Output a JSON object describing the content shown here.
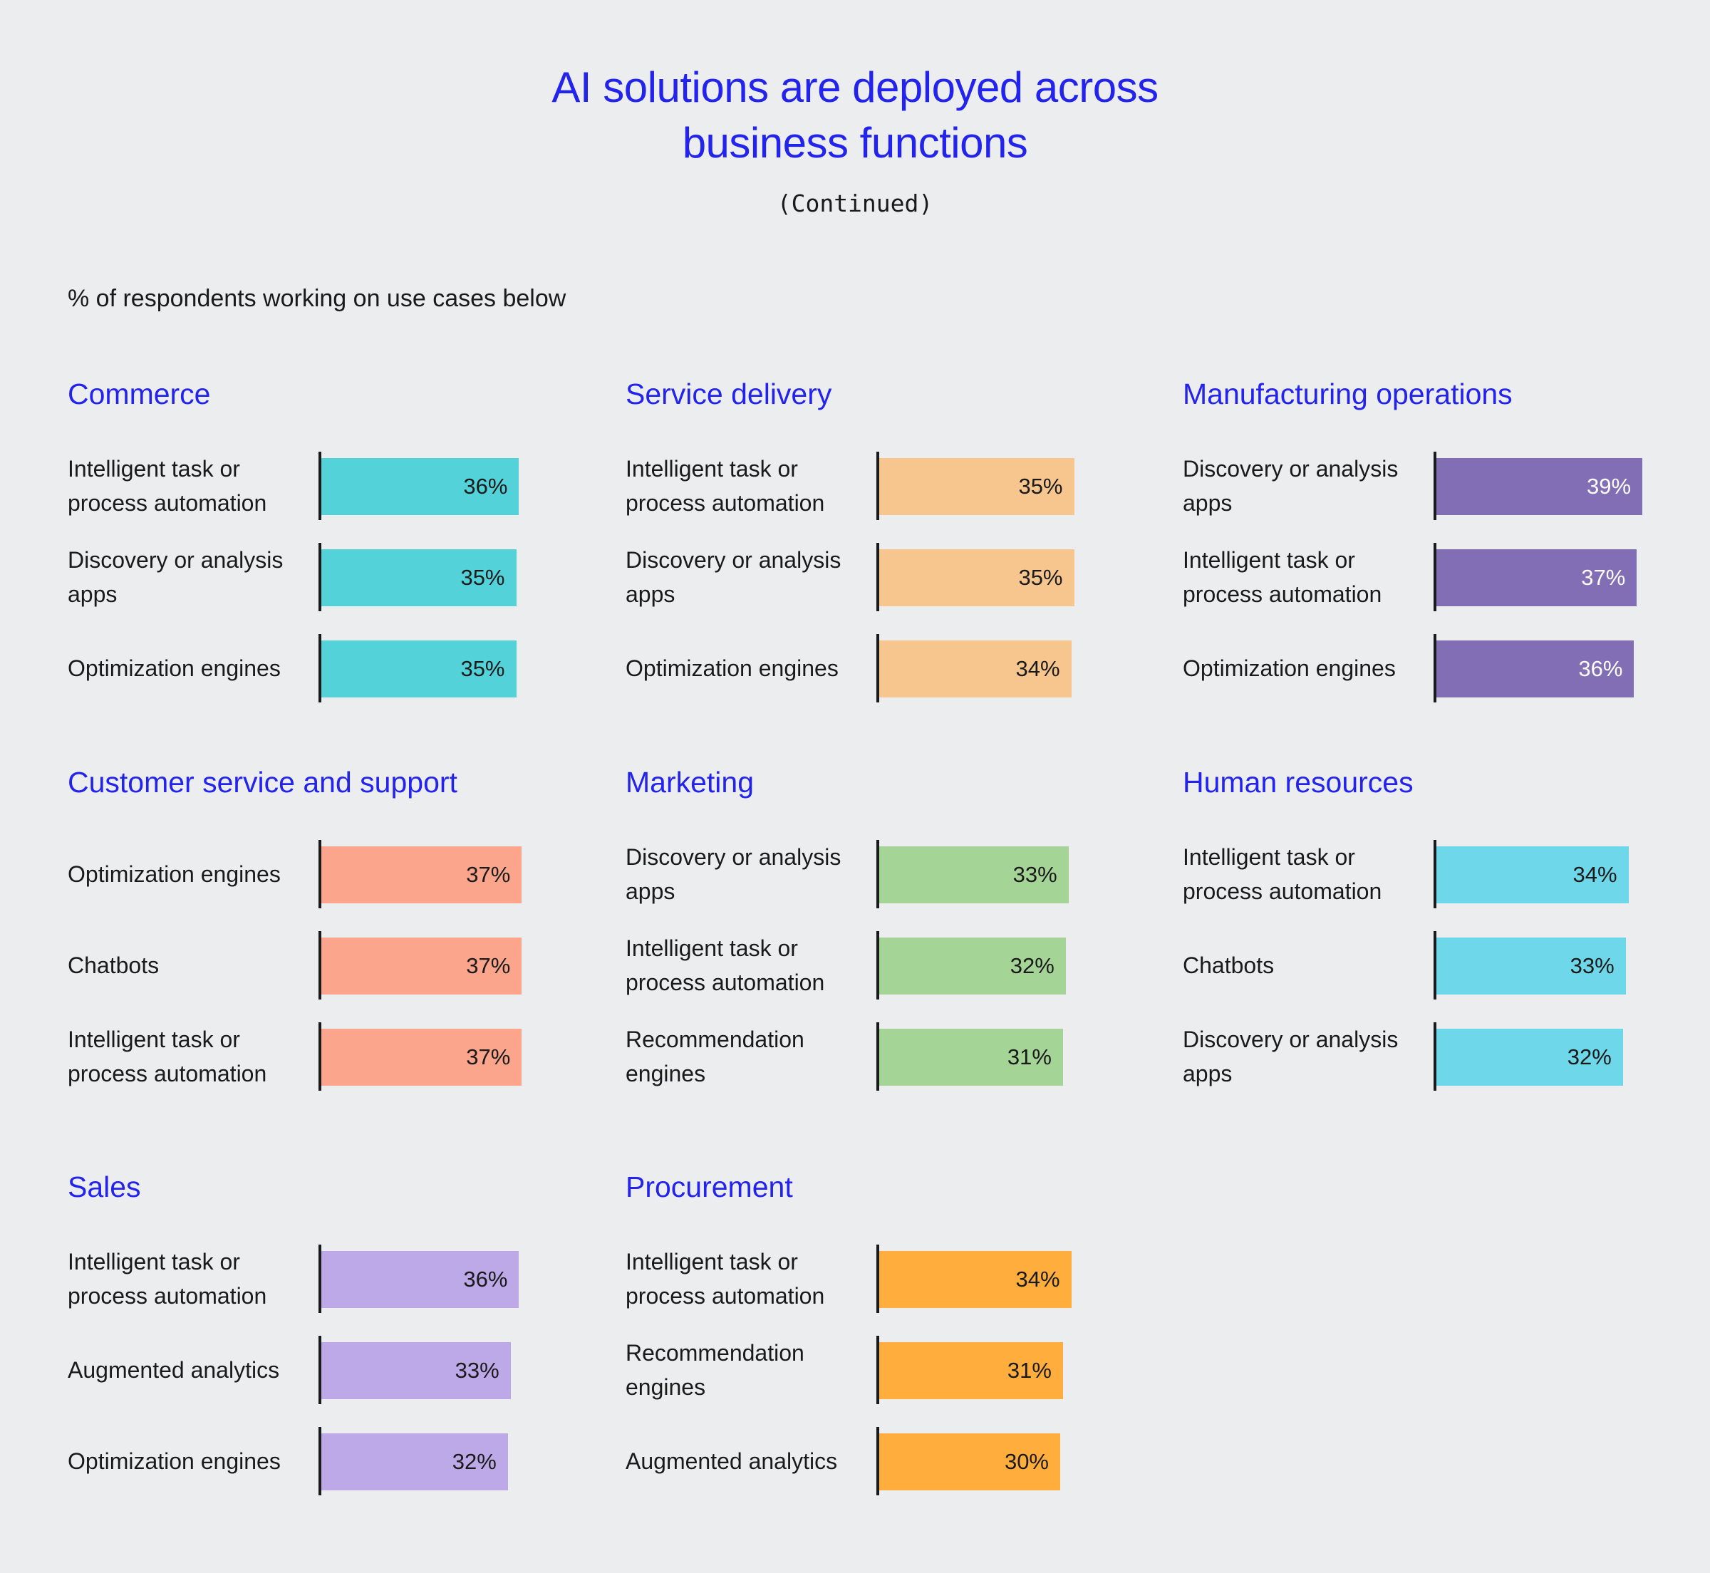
{
  "header": {
    "title_line1": "AI solutions are deployed across",
    "title_line2": "business functions",
    "continued": "(Continued)",
    "subtitle": "% of respondents working on use cases below"
  },
  "chart_data": [
    {
      "type": "bar",
      "title": "Commerce",
      "color": "#53D3D9",
      "label_color": "#1a1a1a",
      "categories": [
        "Intelligent task or process automation",
        "Discovery or analysis apps",
        "Optimization engines"
      ],
      "values": [
        36,
        35,
        35
      ],
      "value_labels": [
        "36%",
        "35%",
        "35%"
      ]
    },
    {
      "type": "bar",
      "title": "Service delivery",
      "color": "#F6C68E",
      "label_color": "#1a1a1a",
      "categories": [
        "Intelligent task or process automation",
        "Discovery or analysis apps",
        "Optimization engines"
      ],
      "values": [
        35,
        35,
        34
      ],
      "value_labels": [
        "35%",
        "35%",
        "34%"
      ]
    },
    {
      "type": "bar",
      "title": "Manufacturing operations",
      "color": "#826EB4",
      "label_color": "#ffffff",
      "categories": [
        "Discovery or analysis apps",
        "Intelligent task or process automation",
        "Optimization engines"
      ],
      "values": [
        39,
        37,
        36
      ],
      "value_labels": [
        "39%",
        "37%",
        "36%"
      ]
    },
    {
      "type": "bar",
      "title": "Customer service and support",
      "color": "#FCA58D",
      "label_color": "#1a1a1a",
      "categories": [
        "Optimization engines",
        "Chatbots",
        "Intelligent task or process automation"
      ],
      "values": [
        37,
        37,
        37
      ],
      "value_labels": [
        "37%",
        "37%",
        "37%"
      ]
    },
    {
      "type": "bar",
      "title": "Marketing",
      "color": "#A5D497",
      "label_color": "#1a1a1a",
      "categories": [
        "Discovery or analysis apps",
        "Intelligent task or process automation",
        "Recommendation engines"
      ],
      "values": [
        33,
        32,
        31
      ],
      "value_labels": [
        "33%",
        "32%",
        "31%"
      ]
    },
    {
      "type": "bar",
      "title": "Human resources",
      "color": "#6ED7E9",
      "label_color": "#1a1a1a",
      "categories": [
        "Intelligent task or process automation",
        "Chatbots",
        "Discovery or analysis apps"
      ],
      "values": [
        34,
        33,
        32
      ],
      "value_labels": [
        "34%",
        "33%",
        "32%"
      ]
    },
    {
      "type": "bar",
      "title": "Sales",
      "color": "#BDA8E8",
      "label_color": "#1a1a1a",
      "categories": [
        "Intelligent task or process automation",
        "Augmented analytics",
        "Optimization engines"
      ],
      "values": [
        36,
        33,
        32
      ],
      "value_labels": [
        "36%",
        "33%",
        "32%"
      ]
    },
    {
      "type": "bar",
      "title": "Procurement",
      "color": "#FFAE3D",
      "label_color": "#1a1a1a",
      "categories": [
        "Intelligent task or process automation",
        "Recommendation engines",
        "Augmented analytics"
      ],
      "values": [
        34,
        31,
        30
      ],
      "value_labels": [
        "34%",
        "31%",
        "30%"
      ]
    }
  ]
}
